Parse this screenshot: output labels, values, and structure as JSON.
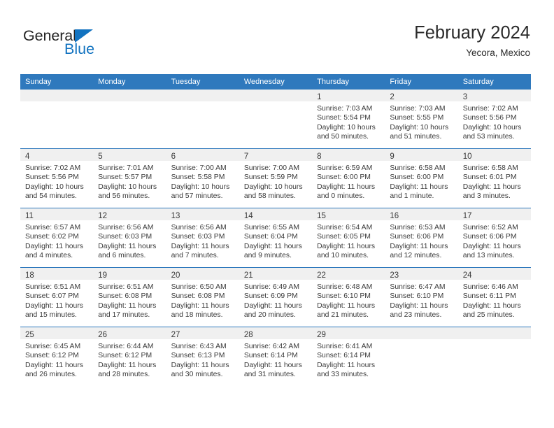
{
  "brand": {
    "name_top": "General",
    "name_bottom": "Blue",
    "triangle_color": "#1273c0",
    "top_text_color": "#232323"
  },
  "header": {
    "title": "February 2024",
    "subtitle": "Yecora, Mexico"
  },
  "theme": {
    "header_row_bg": "#2f79bd",
    "row_divider": "#2f79bd",
    "daynum_strip_bg": "#f0f0f0",
    "text_color": "#3a3a3a"
  },
  "weekdays": [
    "Sunday",
    "Monday",
    "Tuesday",
    "Wednesday",
    "Thursday",
    "Friday",
    "Saturday"
  ],
  "weeks": [
    [
      {
        "empty": true
      },
      {
        "empty": true
      },
      {
        "empty": true
      },
      {
        "empty": true
      },
      {
        "day": "1",
        "sunrise": "Sunrise: 7:03 AM",
        "sunset": "Sunset: 5:54 PM",
        "daylight1": "Daylight: 10 hours",
        "daylight2": "and 50 minutes."
      },
      {
        "day": "2",
        "sunrise": "Sunrise: 7:03 AM",
        "sunset": "Sunset: 5:55 PM",
        "daylight1": "Daylight: 10 hours",
        "daylight2": "and 51 minutes."
      },
      {
        "day": "3",
        "sunrise": "Sunrise: 7:02 AM",
        "sunset": "Sunset: 5:56 PM",
        "daylight1": "Daylight: 10 hours",
        "daylight2": "and 53 minutes."
      }
    ],
    [
      {
        "day": "4",
        "sunrise": "Sunrise: 7:02 AM",
        "sunset": "Sunset: 5:56 PM",
        "daylight1": "Daylight: 10 hours",
        "daylight2": "and 54 minutes."
      },
      {
        "day": "5",
        "sunrise": "Sunrise: 7:01 AM",
        "sunset": "Sunset: 5:57 PM",
        "daylight1": "Daylight: 10 hours",
        "daylight2": "and 56 minutes."
      },
      {
        "day": "6",
        "sunrise": "Sunrise: 7:00 AM",
        "sunset": "Sunset: 5:58 PM",
        "daylight1": "Daylight: 10 hours",
        "daylight2": "and 57 minutes."
      },
      {
        "day": "7",
        "sunrise": "Sunrise: 7:00 AM",
        "sunset": "Sunset: 5:59 PM",
        "daylight1": "Daylight: 10 hours",
        "daylight2": "and 58 minutes."
      },
      {
        "day": "8",
        "sunrise": "Sunrise: 6:59 AM",
        "sunset": "Sunset: 6:00 PM",
        "daylight1": "Daylight: 11 hours",
        "daylight2": "and 0 minutes."
      },
      {
        "day": "9",
        "sunrise": "Sunrise: 6:58 AM",
        "sunset": "Sunset: 6:00 PM",
        "daylight1": "Daylight: 11 hours",
        "daylight2": "and 1 minute."
      },
      {
        "day": "10",
        "sunrise": "Sunrise: 6:58 AM",
        "sunset": "Sunset: 6:01 PM",
        "daylight1": "Daylight: 11 hours",
        "daylight2": "and 3 minutes."
      }
    ],
    [
      {
        "day": "11",
        "sunrise": "Sunrise: 6:57 AM",
        "sunset": "Sunset: 6:02 PM",
        "daylight1": "Daylight: 11 hours",
        "daylight2": "and 4 minutes."
      },
      {
        "day": "12",
        "sunrise": "Sunrise: 6:56 AM",
        "sunset": "Sunset: 6:03 PM",
        "daylight1": "Daylight: 11 hours",
        "daylight2": "and 6 minutes."
      },
      {
        "day": "13",
        "sunrise": "Sunrise: 6:56 AM",
        "sunset": "Sunset: 6:03 PM",
        "daylight1": "Daylight: 11 hours",
        "daylight2": "and 7 minutes."
      },
      {
        "day": "14",
        "sunrise": "Sunrise: 6:55 AM",
        "sunset": "Sunset: 6:04 PM",
        "daylight1": "Daylight: 11 hours",
        "daylight2": "and 9 minutes."
      },
      {
        "day": "15",
        "sunrise": "Sunrise: 6:54 AM",
        "sunset": "Sunset: 6:05 PM",
        "daylight1": "Daylight: 11 hours",
        "daylight2": "and 10 minutes."
      },
      {
        "day": "16",
        "sunrise": "Sunrise: 6:53 AM",
        "sunset": "Sunset: 6:06 PM",
        "daylight1": "Daylight: 11 hours",
        "daylight2": "and 12 minutes."
      },
      {
        "day": "17",
        "sunrise": "Sunrise: 6:52 AM",
        "sunset": "Sunset: 6:06 PM",
        "daylight1": "Daylight: 11 hours",
        "daylight2": "and 13 minutes."
      }
    ],
    [
      {
        "day": "18",
        "sunrise": "Sunrise: 6:51 AM",
        "sunset": "Sunset: 6:07 PM",
        "daylight1": "Daylight: 11 hours",
        "daylight2": "and 15 minutes."
      },
      {
        "day": "19",
        "sunrise": "Sunrise: 6:51 AM",
        "sunset": "Sunset: 6:08 PM",
        "daylight1": "Daylight: 11 hours",
        "daylight2": "and 17 minutes."
      },
      {
        "day": "20",
        "sunrise": "Sunrise: 6:50 AM",
        "sunset": "Sunset: 6:08 PM",
        "daylight1": "Daylight: 11 hours",
        "daylight2": "and 18 minutes."
      },
      {
        "day": "21",
        "sunrise": "Sunrise: 6:49 AM",
        "sunset": "Sunset: 6:09 PM",
        "daylight1": "Daylight: 11 hours",
        "daylight2": "and 20 minutes."
      },
      {
        "day": "22",
        "sunrise": "Sunrise: 6:48 AM",
        "sunset": "Sunset: 6:10 PM",
        "daylight1": "Daylight: 11 hours",
        "daylight2": "and 21 minutes."
      },
      {
        "day": "23",
        "sunrise": "Sunrise: 6:47 AM",
        "sunset": "Sunset: 6:10 PM",
        "daylight1": "Daylight: 11 hours",
        "daylight2": "and 23 minutes."
      },
      {
        "day": "24",
        "sunrise": "Sunrise: 6:46 AM",
        "sunset": "Sunset: 6:11 PM",
        "daylight1": "Daylight: 11 hours",
        "daylight2": "and 25 minutes."
      }
    ],
    [
      {
        "day": "25",
        "sunrise": "Sunrise: 6:45 AM",
        "sunset": "Sunset: 6:12 PM",
        "daylight1": "Daylight: 11 hours",
        "daylight2": "and 26 minutes."
      },
      {
        "day": "26",
        "sunrise": "Sunrise: 6:44 AM",
        "sunset": "Sunset: 6:12 PM",
        "daylight1": "Daylight: 11 hours",
        "daylight2": "and 28 minutes."
      },
      {
        "day": "27",
        "sunrise": "Sunrise: 6:43 AM",
        "sunset": "Sunset: 6:13 PM",
        "daylight1": "Daylight: 11 hours",
        "daylight2": "and 30 minutes."
      },
      {
        "day": "28",
        "sunrise": "Sunrise: 6:42 AM",
        "sunset": "Sunset: 6:14 PM",
        "daylight1": "Daylight: 11 hours",
        "daylight2": "and 31 minutes."
      },
      {
        "day": "29",
        "sunrise": "Sunrise: 6:41 AM",
        "sunset": "Sunset: 6:14 PM",
        "daylight1": "Daylight: 11 hours",
        "daylight2": "and 33 minutes."
      },
      {
        "empty": true
      },
      {
        "empty": true
      }
    ]
  ]
}
